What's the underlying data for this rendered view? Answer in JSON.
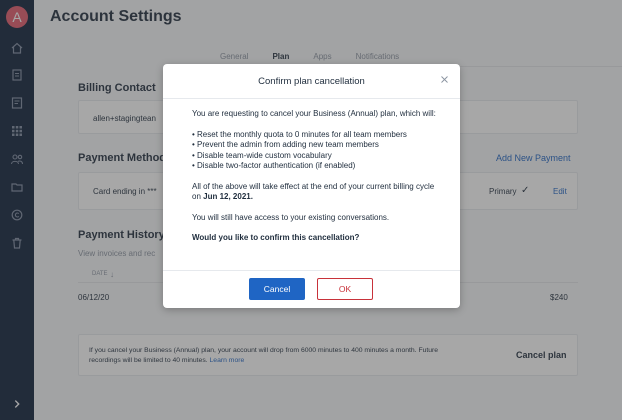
{
  "sidebar": {
    "avatar_letter": "A",
    "icons": [
      "home-icon",
      "document-icon",
      "notes-icon",
      "apps-grid-icon",
      "people-icon",
      "folder-icon",
      "copyright-icon",
      "trash-icon"
    ],
    "expand_icon": "chevron-right-icon"
  },
  "page": {
    "title": "Account Settings",
    "tabs": [
      {
        "label": "General",
        "active": false
      },
      {
        "label": "Plan",
        "active": true
      },
      {
        "label": "Apps",
        "active": false
      },
      {
        "label": "Notifications",
        "active": false
      }
    ]
  },
  "billing_contact": {
    "title": "Billing Contact",
    "email_partial": "allen+stagingtean"
  },
  "payment_method": {
    "title": "Payment Method",
    "add_link": "Add New Payment",
    "card_text": "Card ending in ***",
    "primary_label": "Primary",
    "edit_link": "Edit"
  },
  "payment_history": {
    "title": "Payment History",
    "subtitle": "View invoices and rec",
    "date_header": "DATE",
    "row_date": "06/12/20",
    "row_amount": "$240"
  },
  "cancel_notice": {
    "text": "If you cancel your Business (Annual) plan, your account will drop from 6000 minutes to 400 minutes a month. Future recordings will be limited to 40 minutes.",
    "learn_more": "Learn more",
    "cancel_plan_label": "Cancel plan"
  },
  "modal": {
    "title": "Confirm plan cancellation",
    "intro": "You are requesting to cancel your Business (Annual) plan, which will:",
    "bullets": [
      "Reset the monthly quota to 0 minutes for all team members",
      "Prevent the admin from adding new team members",
      "Disable team-wide custom vocabulary",
      "Disable two-factor authentication (if enabled)"
    ],
    "effect_prefix": "All of the above will take effect at the end of your current billing cycle on",
    "effect_date": "Jun 12, 2021.",
    "access_note": "You will still have access to your existing conversations.",
    "question": "Would you like to confirm this cancellation?",
    "cancel_button": "Cancel",
    "ok_button": "OK"
  },
  "colors": {
    "sidebar_bg": "#0d1f3a",
    "avatar_bg": "#e35a6c",
    "primary_blue": "#1f65c4",
    "danger_red": "#c8323a"
  }
}
